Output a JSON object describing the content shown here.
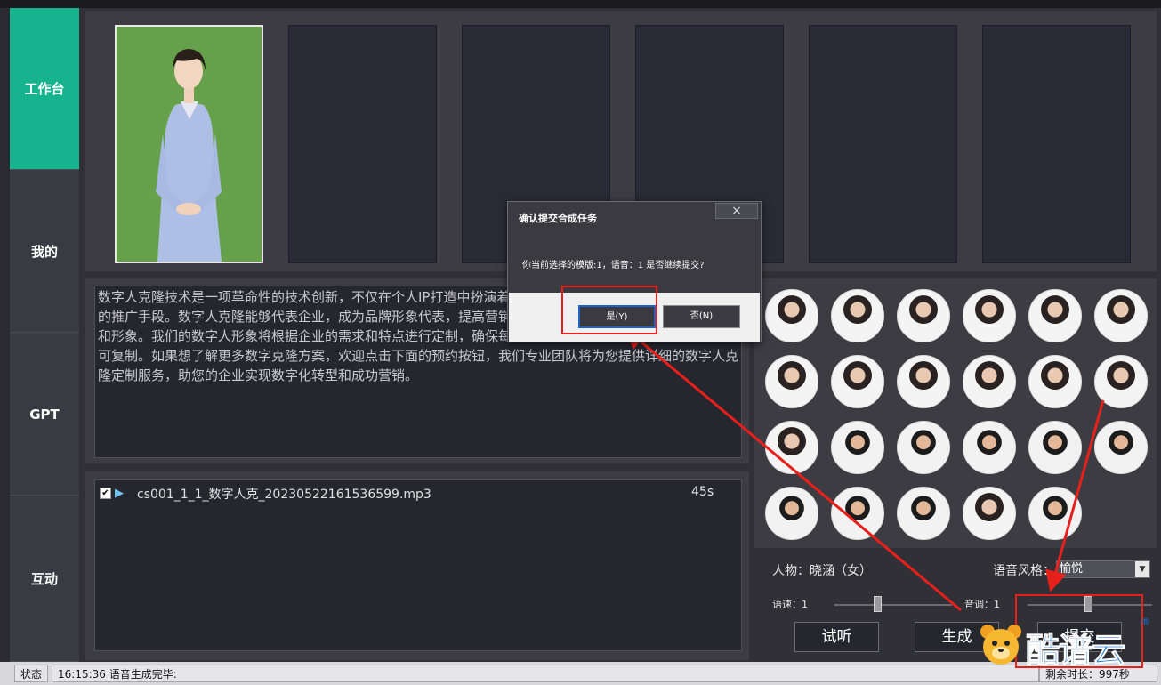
{
  "sidebar": {
    "items": [
      {
        "label": "工作台",
        "active": true
      },
      {
        "label": "我的"
      },
      {
        "label": "GPT"
      },
      {
        "label": "互动"
      }
    ]
  },
  "script_text": "数字人克隆技术是一项革命性的技术创新，不仅在个人IP打造中扮演着重要的角色，也为企业提供了便捷高效的推广手段。数字人克隆能够代表企业，成为品牌形象代表，提高营销效果和用户体验，从而提高品牌知名度和形象。我们的数字人形象将根据企业的需求和特点进行定制，确保每一个企业的数字人克隆都独具特色，无可复制。如果想了解更多数字克隆方案，欢迎点击下面的预约按钮，我们专业团队将为您提供详细的数字人克隆定制服务，助您的企业实现数字化转型和成功营销。",
  "audio_list": [
    {
      "checked": true,
      "filename": "cs001_1_1_数字人克_20230522161536599.mp3",
      "duration": "45s"
    }
  ],
  "controls": {
    "character_label": "人物：晓涵（女）",
    "voice_style_label": "语音风格：",
    "voice_style_value": "愉悦",
    "speed_label": "语速：1",
    "speed_value": 1,
    "pitch_label": "音调：1",
    "pitch_value": 1,
    "preview_button": "试听",
    "generate_button": "生成",
    "submit_button": "提交"
  },
  "status_bar": {
    "state_label": "状态",
    "message": "16:15:36 语音生成完毕:",
    "remaining": "剩余时长：997秒"
  },
  "dialog": {
    "title": "确认提交合成任务",
    "close_glyph": "×",
    "message": "你当前选择的模版:1，语音：1 是否继续提交?",
    "yes_button": "是(Y)",
    "no_button": "否(N)"
  },
  "watermark": {
    "text": "酷谱云",
    "registered": "®"
  },
  "colors": {
    "accent": "#16b38f",
    "annotation": "#e8201c",
    "brand": "#1874d8"
  }
}
